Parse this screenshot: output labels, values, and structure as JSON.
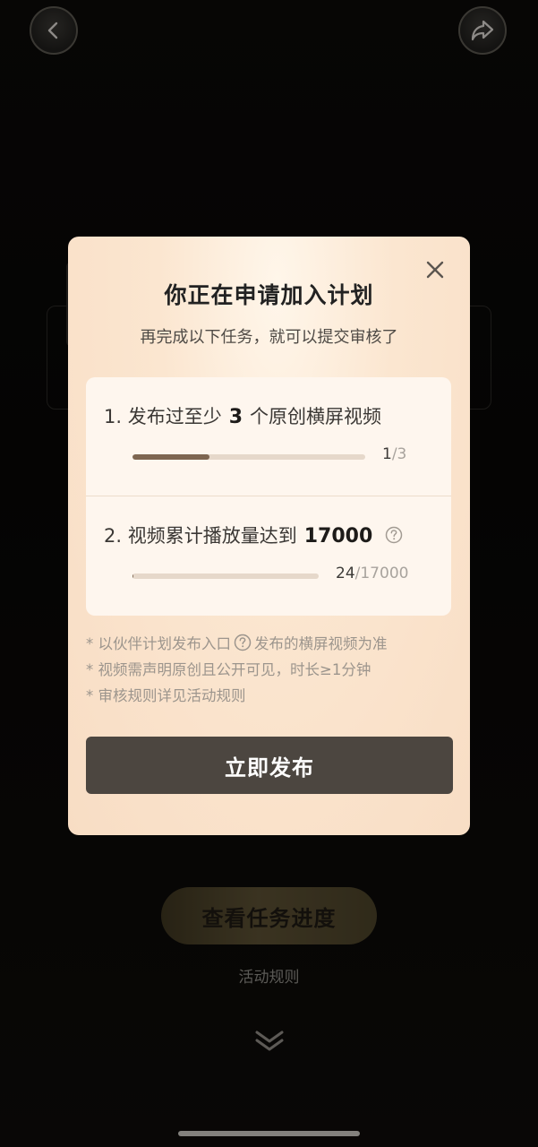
{
  "modal": {
    "title": "你正在申请加入计划",
    "subtitle": "再完成以下任务，就可以提交审核了",
    "tasks": [
      {
        "prefix": "1. 发布过至少",
        "highlight": "3",
        "suffix": "个原创横屏视频",
        "progress_current": "1",
        "progress_total": "/3",
        "progress_fraction": 0.33
      },
      {
        "prefix": "2. 视频累计播放量达到",
        "highlight": "17000",
        "suffix": "",
        "progress_current": "24",
        "progress_total": "/17000",
        "progress_fraction": 0.0014
      }
    ],
    "notes": {
      "line1_a": "* 以伙伴计划发布入口",
      "line1_b": "发布的横屏视频为准",
      "line2": "* 视频需声明原创且公开可见，时长≥1分钟",
      "line3": "* 审核规则详见活动规则"
    },
    "publish_label": "立即发布"
  },
  "background": {
    "progress_button_label": "查看任务进度",
    "rules_link": "活动规则"
  },
  "colors": {
    "modal_bg": "#fbe6d0",
    "publish_button": "#4c4640",
    "progress_fill": "#7e6651",
    "progress_track": "#e6d8ca"
  },
  "icons": {
    "back": "chevron-left-icon",
    "share": "share-arrow-icon",
    "close": "close-icon",
    "help": "question-circle-icon",
    "scroll": "double-chevron-down-icon"
  }
}
